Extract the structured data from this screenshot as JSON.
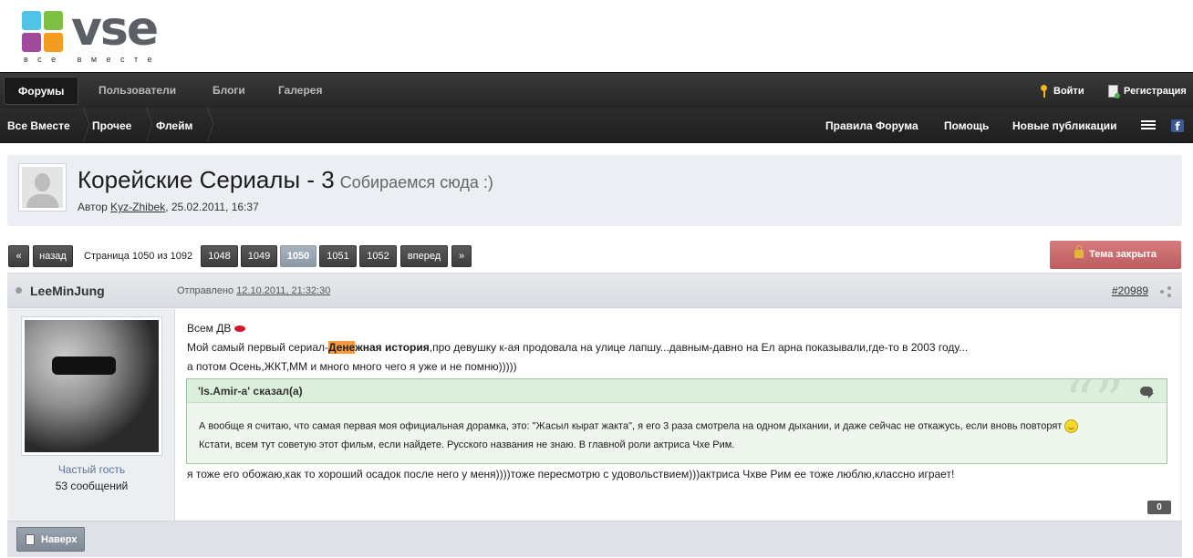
{
  "logo": {
    "text": "vse",
    "tagline": "все вместе",
    "colors": [
      "#4fc3e8",
      "#7dc043",
      "#a04a9c",
      "#f39c1f"
    ]
  },
  "primary_nav": [
    {
      "label": "Форумы",
      "active": true
    },
    {
      "label": "Пользователи",
      "active": false
    },
    {
      "label": "Блоги",
      "active": false
    },
    {
      "label": "Галерея",
      "active": false
    }
  ],
  "user_nav": {
    "sign_in": "Войти",
    "register": "Регистрация"
  },
  "breadcrumbs": [
    "Все Вместе",
    "Прочее",
    "Флейм"
  ],
  "secondary_nav": [
    "Правила Форума",
    "Помощь",
    "Новые публикации"
  ],
  "topic": {
    "title": "Корейские Сериалы - 3",
    "description": "Собираемся сюда :)",
    "author_prefix": "Автор",
    "author": "Kyz-Zhibek",
    "date": ", 25.02.2011, 16:37"
  },
  "pagination": {
    "first": "«",
    "prev": "назад",
    "info": "Страница 1050 из 1092",
    "pages": [
      "1048",
      "1049",
      "1050",
      "1051",
      "1052"
    ],
    "current": "1050",
    "next": "вперед",
    "last": "»",
    "locked_label": "Тема закрыта"
  },
  "post": {
    "author": "LeeMinJung",
    "posted_prefix": "Отправлено",
    "posted_time": "12.10.2011, 21:32:30",
    "number": "#20989",
    "author_group": "Частый гость",
    "author_posts": "53 сообщений",
    "lines": {
      "l1": "Всем ДВ",
      "l2_pre": "Мой самый первый сериал-",
      "l2_hl": "Дене",
      "l2_bold": "жная история",
      "l2_post": ",про девушку к-ая продовала на улице лапшу...давным-давно на Ел арна показывали,где-то в 2003 году...",
      "l3": "а потом Осень,ЖКТ,ММ и много много чего я уже и не помню)))))",
      "l4": "я тоже его обожаю,как то хороший осадок после него у меня))))тоже пересмотрю с удовольствием)))актриса Чхве Рим ее тоже люблю,классно играет!"
    },
    "quote": {
      "cite": "'Is.Amir-a' сказал(а)",
      "line1": "А вообще я считаю, что самая первая моя официальная дорамка, это: \"Жасыл кырат жакта\", я его 3 раза смотрела на одном дыхании, и даже сейчас не откажусь, если вновь повторят",
      "line2": "Кстати, всем тут советую этот фильм, если найдете. Русского названия не знаю. В главной роли актриса Чхе Рим."
    },
    "reputation": "0",
    "top_button": "Наверх"
  }
}
